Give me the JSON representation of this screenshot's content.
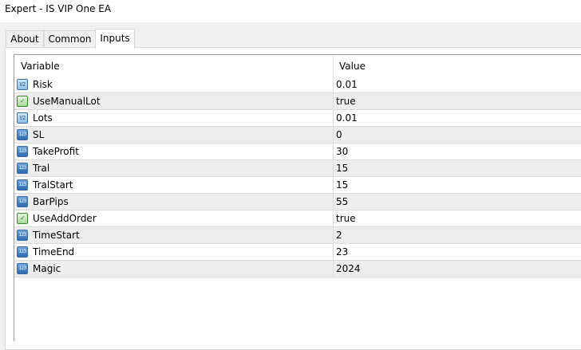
{
  "window": {
    "title": "Expert - IS VIP One EA"
  },
  "tabs": [
    {
      "label": "About"
    },
    {
      "label": "Common"
    },
    {
      "label": "Inputs"
    }
  ],
  "grid": {
    "columns": {
      "variable": "Variable",
      "value": "Value"
    },
    "rows": [
      {
        "icon": "double-value-icon",
        "glyph": "V2",
        "name": "Risk",
        "value": "0.01"
      },
      {
        "icon": "boolean-value-icon",
        "glyph": "✓",
        "name": "UseManualLot",
        "value": "true"
      },
      {
        "icon": "double-value-icon",
        "glyph": "V2",
        "name": "Lots",
        "value": "0.01"
      },
      {
        "icon": "integer-value-icon",
        "glyph": "123",
        "name": "SL",
        "value": "0"
      },
      {
        "icon": "integer-value-icon",
        "glyph": "123",
        "name": "TakeProfit",
        "value": "30"
      },
      {
        "icon": "integer-value-icon",
        "glyph": "123",
        "name": "Tral",
        "value": "15"
      },
      {
        "icon": "integer-value-icon",
        "glyph": "123",
        "name": "TralStart",
        "value": "15"
      },
      {
        "icon": "integer-value-icon",
        "glyph": "123",
        "name": "BarPips",
        "value": "55"
      },
      {
        "icon": "boolean-value-icon",
        "glyph": "✓",
        "name": "UseAddOrder",
        "value": "true"
      },
      {
        "icon": "integer-value-icon",
        "glyph": "123",
        "name": "TimeStart",
        "value": "2"
      },
      {
        "icon": "integer-value-icon",
        "glyph": "123",
        "name": "TimeEnd",
        "value": "23"
      },
      {
        "icon": "integer-value-icon",
        "glyph": "123",
        "name": "Magic",
        "value": "2024"
      }
    ]
  }
}
